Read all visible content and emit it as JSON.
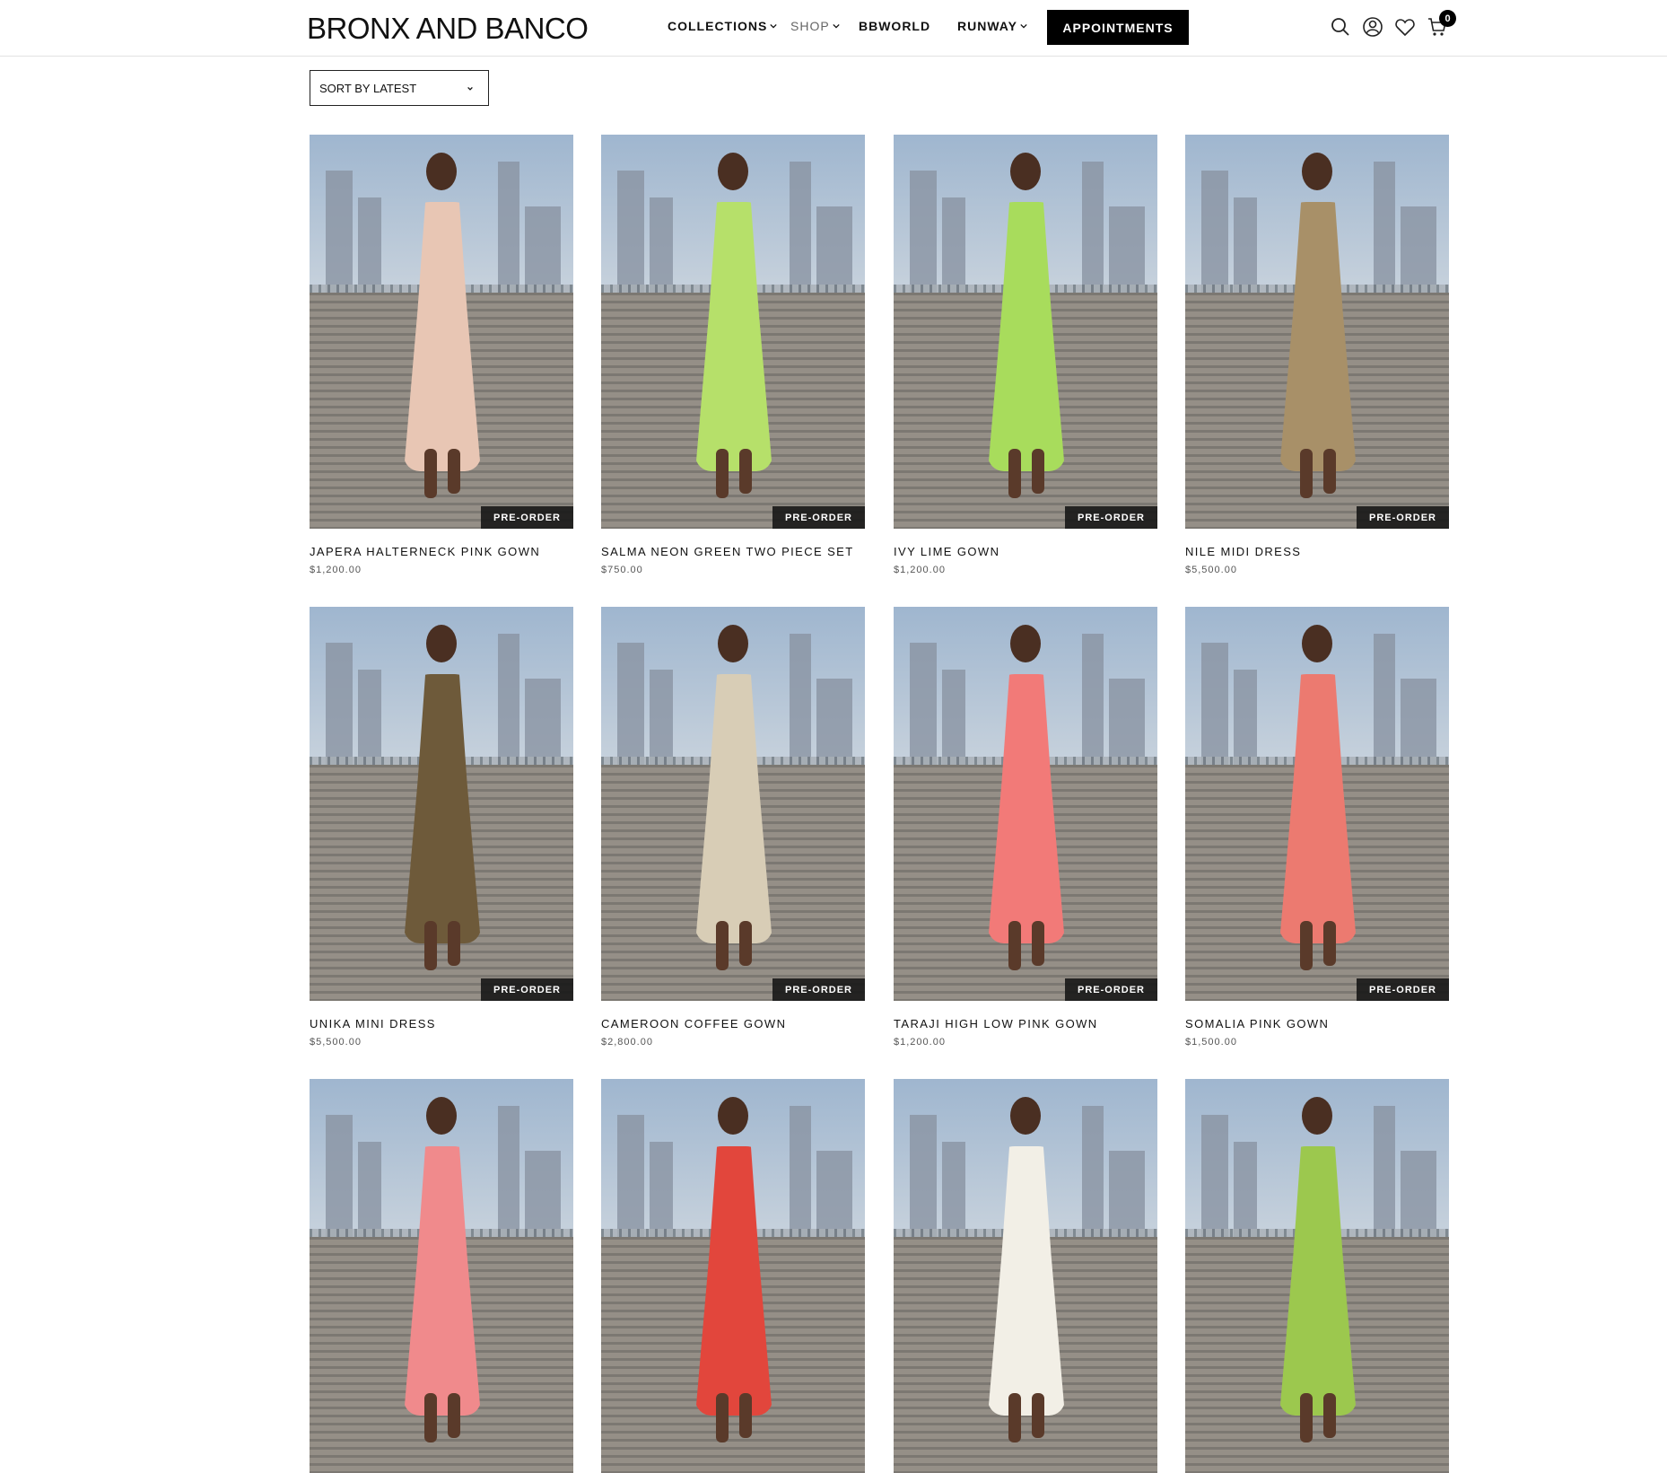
{
  "header": {
    "logo": "BRONX AND BANCO",
    "nav": [
      {
        "label": "COLLECTIONS"
      },
      {
        "label": "SHOP"
      },
      {
        "label": "BBWORLD"
      },
      {
        "label": "RUNWAY"
      }
    ],
    "appointments_label": "APPOINTMENTS",
    "cart_count": "0",
    "icons": [
      "search-icon",
      "account-icon",
      "wishlist-heart-icon",
      "cart-icon"
    ]
  },
  "sort": {
    "label": "SORT BY LATEST"
  },
  "badge_label": "PRE-ORDER",
  "products": [
    {
      "name": "JAPERA HALTERNECK PINK GOWN",
      "price": "$1,200.00",
      "dress_color": "#e8c6b4"
    },
    {
      "name": "SALMA NEON GREEN TWO PIECE SET",
      "price": "$750.00",
      "dress_color": "#b6e06a"
    },
    {
      "name": "IVY LIME GOWN",
      "price": "$1,200.00",
      "dress_color": "#a8dc5c"
    },
    {
      "name": "NILE MIDI DRESS",
      "price": "$5,500.00",
      "dress_color": "#a89068"
    },
    {
      "name": "UNIKA MINI DRESS",
      "price": "$5,500.00",
      "dress_color": "#6e5a3a"
    },
    {
      "name": "CAMEROON COFFEE GOWN",
      "price": "$2,800.00",
      "dress_color": "#d8cdb6"
    },
    {
      "name": "TARAJI HIGH LOW PINK GOWN",
      "price": "$1,200.00",
      "dress_color": "#f27a78"
    },
    {
      "name": "SOMALIA PINK GOWN",
      "price": "$1,500.00",
      "dress_color": "#ec7a70"
    },
    {
      "name": "",
      "price": "",
      "dress_color": "#f08a8c"
    },
    {
      "name": "",
      "price": "",
      "dress_color": "#e2463c"
    },
    {
      "name": "",
      "price": "",
      "dress_color": "#f2efe6"
    },
    {
      "name": "",
      "price": "",
      "dress_color": "#9cc84e"
    }
  ]
}
